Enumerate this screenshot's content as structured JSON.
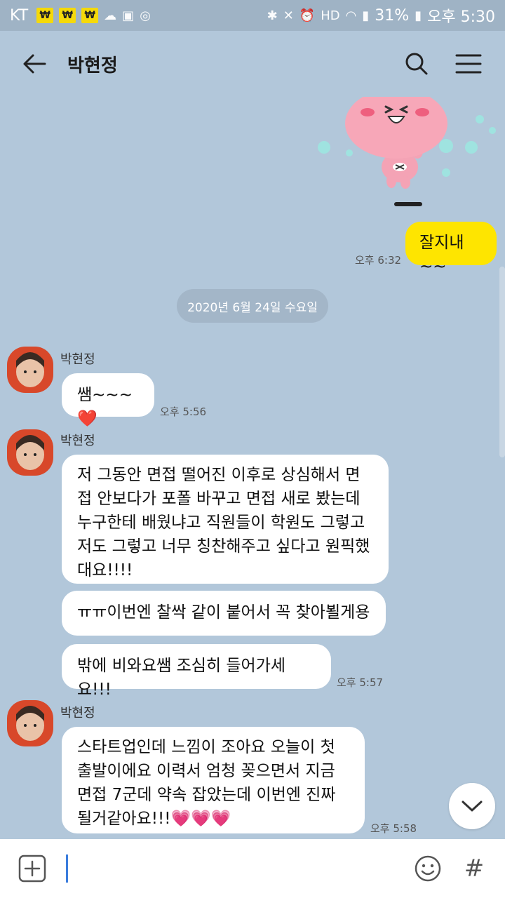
{
  "status": {
    "carrier": "KT",
    "battery": "31%",
    "time": "오후 5:30",
    "won_symbol": "₩"
  },
  "header": {
    "title": "박현정"
  },
  "messages": {
    "mine_text": "잘지내~~",
    "mine_time": "오후 6:32",
    "date_divider": "2020년 6월 24일 수요일",
    "sender": "박현정",
    "m1": "쌤~~~❤️",
    "m1_time": "오후 5:56",
    "m2": "저 그동안 면접 떨어진 이후로 상심해서 면접 안보다가 포폴 바꾸고 면접 새로 봤는데 누구한테 배웠냐고 직원들이 학원도 그렇고 저도 그렇고 너무 칭찬해주고 싶다고 원픽했대요!!!!",
    "m3": "ㅠㅠ이번엔 찰싹 같이 붙어서 꼭 찾아뵐게용",
    "m4": "밖에 비와요쌤 조심히 들어가세요!!!",
    "m4_time": "오후 5:57",
    "m5": "스타트업인데 느낌이 조아요 오늘이 첫출발이에요 이력서 엄청 꽂으면서 지금 면접 7군데 약속 잡았는데 이번엔 진짜 될거같아요!!!💗💗💗",
    "m5_time": "오후 5:58"
  },
  "input": {
    "hash": "#"
  }
}
